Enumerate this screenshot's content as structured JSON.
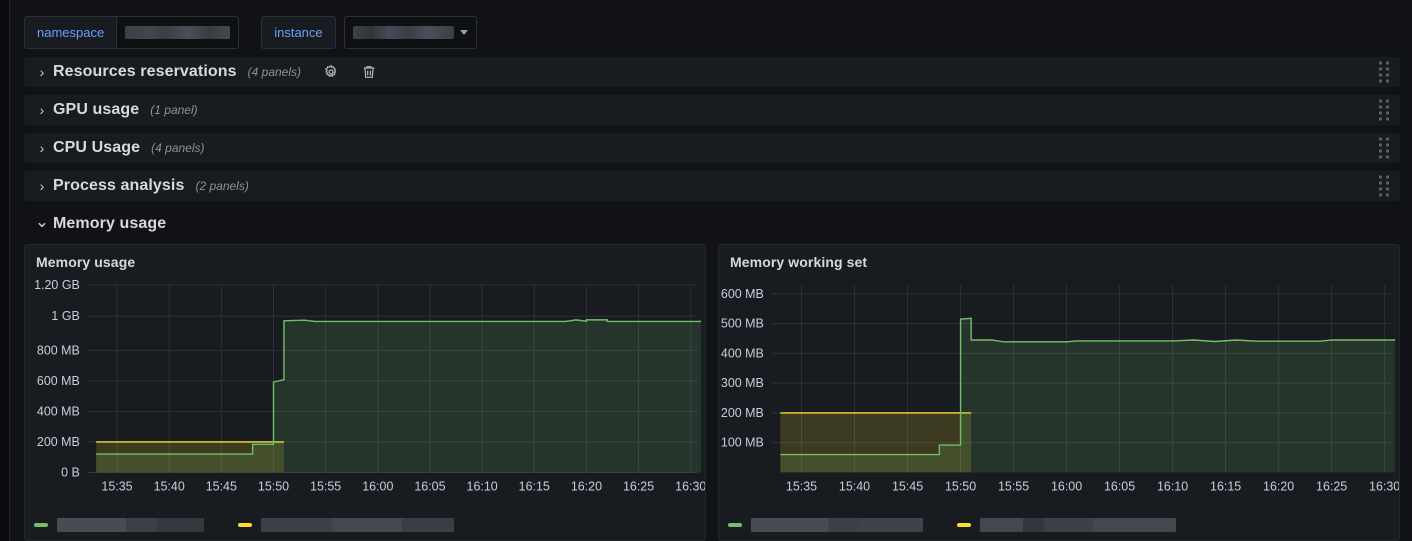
{
  "variables": [
    {
      "name": "namespace",
      "label": "namespace",
      "value": "",
      "redacted": true,
      "has_dropdown": false
    },
    {
      "name": "instance",
      "label": "instance",
      "value": "",
      "redacted": true,
      "has_dropdown": true
    }
  ],
  "rows": [
    {
      "title": "Resources reservations",
      "count": "(4 panels)",
      "collapsed": true,
      "chevron": "›",
      "icons": [
        "gear-icon",
        "trash-icon"
      ]
    },
    {
      "title": "GPU usage",
      "count": "(1 panel)",
      "collapsed": true,
      "chevron": "›",
      "icons": []
    },
    {
      "title": "CPU Usage",
      "count": "(4 panels)",
      "collapsed": true,
      "chevron": "›",
      "icons": []
    },
    {
      "title": "Process analysis",
      "count": "(2 panels)",
      "collapsed": true,
      "chevron": "›",
      "icons": []
    },
    {
      "title": "Memory usage",
      "count": "",
      "collapsed": false,
      "chevron": "⌄",
      "icons": []
    }
  ],
  "colors": {
    "green": "#73bf69",
    "yellow": "#fade2a",
    "panel_bg": "#181b1f",
    "page_bg": "#111217",
    "grid": "#2f3338",
    "axis_text": "#ccccdc",
    "link_blue": "#6e9fff"
  },
  "panels": [
    {
      "title": "Memory usage",
      "legend_series": 2
    },
    {
      "title": "Memory working set",
      "legend_series": 2
    }
  ],
  "chart_data": [
    {
      "type": "line",
      "title": "Memory usage",
      "xlabel": "",
      "ylabel": "",
      "grid": true,
      "legend_position": "bottom",
      "x_ticks": [
        "15:35",
        "15:40",
        "15:45",
        "15:50",
        "15:55",
        "16:00",
        "16:05",
        "16:10",
        "16:15",
        "16:20",
        "16:25",
        "16:30"
      ],
      "y_ticks": [
        "0 B",
        "200 MB",
        "400 MB",
        "600 MB",
        "800 MB",
        "1 GB",
        "1.20 GB"
      ],
      "ylim": [
        0,
        1288490188
      ],
      "ylim_label": [
        "0 B",
        "1.20 GB"
      ],
      "unit": "bytes",
      "series": [
        {
          "name": "memory usage",
          "color": "#73bf69",
          "fill": true,
          "points": [
            {
              "t": "15:33",
              "v": 125829120
            },
            {
              "t": "15:48",
              "v": 125829120
            },
            {
              "t": "15:48",
              "v": 192937984
            },
            {
              "t": "15:50",
              "v": 192937984
            },
            {
              "t": "15:50",
              "v": 620756992
            },
            {
              "t": "15:51",
              "v": 637534208
            },
            {
              "t": "15:51",
              "v": 1042284544
            },
            {
              "t": "15:53",
              "v": 1046478848
            },
            {
              "t": "15:54",
              "v": 1038090240
            },
            {
              "t": "16:18",
              "v": 1038090240
            },
            {
              "t": "16:19",
              "v": 1048576000
            },
            {
              "t": "16:20",
              "v": 1039138816
            },
            {
              "t": "16:20",
              "v": 1048576000
            },
            {
              "t": "16:22",
              "v": 1048576000
            },
            {
              "t": "16:22",
              "v": 1038090240
            },
            {
              "t": "16:31",
              "v": 1038090240
            }
          ]
        },
        {
          "name": "memory limit",
          "color": "#fade2a",
          "fill": true,
          "points": [
            {
              "t": "15:33",
              "v": 209715200
            },
            {
              "t": "15:51",
              "v": 209715200
            }
          ]
        }
      ]
    },
    {
      "type": "line",
      "title": "Memory working set",
      "xlabel": "",
      "ylabel": "",
      "grid": true,
      "legend_position": "bottom",
      "x_ticks": [
        "15:35",
        "15:40",
        "15:45",
        "15:50",
        "15:55",
        "16:00",
        "16:05",
        "16:10",
        "16:15",
        "16:20",
        "16:25",
        "16:30"
      ],
      "y_ticks": [
        "100 MB",
        "200 MB",
        "300 MB",
        "400 MB",
        "500 MB",
        "600 MB"
      ],
      "ylim": [
        0,
        660602880
      ],
      "ylim_label": [
        "0 B",
        "600 MB"
      ],
      "unit": "bytes",
      "series": [
        {
          "name": "memory working set",
          "color": "#73bf69",
          "fill": true,
          "points": [
            {
              "t": "15:33",
              "v": 62914560
            },
            {
              "t": "15:48",
              "v": 62914560
            },
            {
              "t": "15:48",
              "v": 96468992
            },
            {
              "t": "15:50",
              "v": 96468992
            },
            {
              "t": "15:50",
              "v": 209715200
            },
            {
              "t": "15:50",
              "v": 540016640
            },
            {
              "t": "15:51",
              "v": 543162368
            },
            {
              "t": "15:51",
              "v": 466714624
            },
            {
              "t": "15:53",
              "v": 466714624
            },
            {
              "t": "15:54",
              "v": 460324864
            },
            {
              "t": "16:00",
              "v": 460324864
            },
            {
              "t": "16:01",
              "v": 463470592
            },
            {
              "t": "16:10",
              "v": 463470592
            },
            {
              "t": "16:12",
              "v": 466714624
            },
            {
              "t": "16:14",
              "v": 461373440
            },
            {
              "t": "16:16",
              "v": 466714624
            },
            {
              "t": "16:18",
              "v": 462422016
            },
            {
              "t": "16:24",
              "v": 462422016
            },
            {
              "t": "16:25",
              "v": 466714624
            },
            {
              "t": "16:31",
              "v": 466714624
            }
          ]
        },
        {
          "name": "memory limit",
          "color": "#fade2a",
          "fill": true,
          "points": [
            {
              "t": "15:33",
              "v": 209715200
            },
            {
              "t": "15:51",
              "v": 209715200
            }
          ]
        }
      ]
    }
  ]
}
